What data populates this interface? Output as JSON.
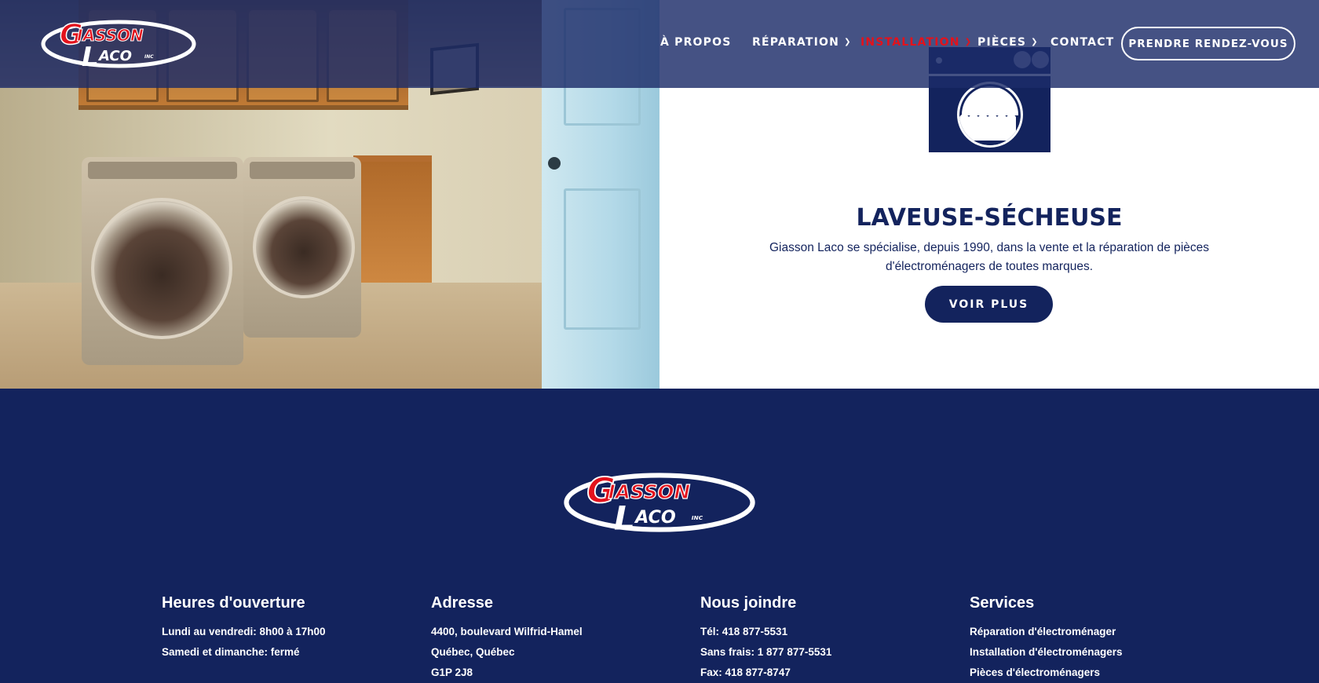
{
  "brand": {
    "logo_line1": "IASSON",
    "logo_line2": "ACO",
    "logo_suffix": "INC",
    "logo_initial1": "G",
    "logo_initial2": "L"
  },
  "nav": {
    "items": [
      {
        "label": "À PROPOS",
        "has_dropdown": false
      },
      {
        "label": "RÉPARATION",
        "has_dropdown": true
      },
      {
        "label": "INSTALLATION",
        "has_dropdown": true,
        "active": true
      },
      {
        "label": "PIÈCES",
        "has_dropdown": true
      },
      {
        "label": "CONTACT",
        "has_dropdown": false
      }
    ],
    "cta": "PRENDRE RENDEZ-VOUS",
    "chevron": "⌄"
  },
  "hero": {
    "icon": "washer-icon",
    "title": "LAVEUSE-SÉCHEUSE",
    "description": "Giasson Laco se spécialise, depuis 1990, dans la vente et la réparation de pièces d'électroménagers de toutes marques.",
    "button": "VOIR PLUS"
  },
  "footer": {
    "columns": [
      {
        "title": "Heures d'ouverture",
        "lines": [
          "Lundi au vendredi: 8h00 à 17h00",
          "Samedi et dimanche: fermé"
        ]
      },
      {
        "title": "Adresse",
        "lines": [
          "4400, boulevard Wilfrid-Hamel",
          "Québec, Québec",
          "G1P 2J8"
        ]
      },
      {
        "title": "Nous joindre",
        "lines": [
          "Tél: 418 877-5531",
          "Sans frais: 1 877 877-5531",
          "Fax: 418 877-8747"
        ]
      },
      {
        "title": "Services",
        "lines": [
          "Réparation d'électroménager",
          "Installation d'électroménagers",
          "Pièces d'électroménagers"
        ]
      }
    ]
  },
  "colors": {
    "navy": "#13235d",
    "brand_red": "#e3121c",
    "white": "#ffffff"
  }
}
